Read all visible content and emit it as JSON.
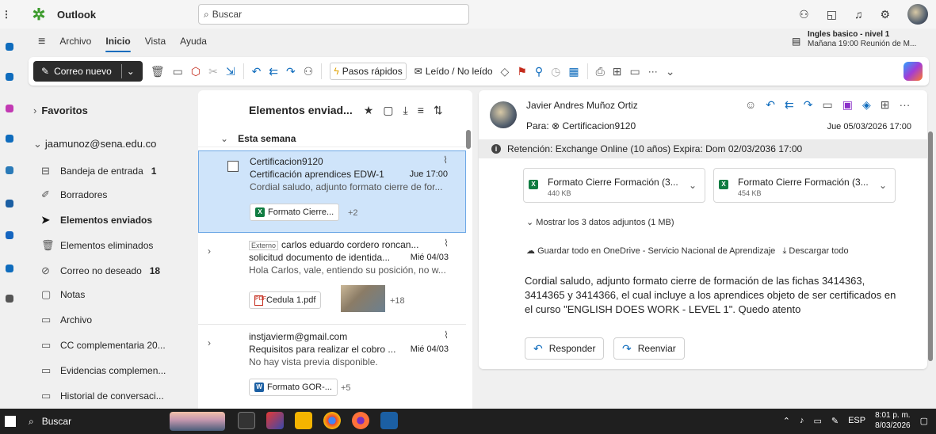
{
  "app": {
    "title": "Outlook",
    "search_placeholder": "Buscar"
  },
  "tabs": [
    "Archivo",
    "Inicio",
    "Vista",
    "Ayuda"
  ],
  "reminder": {
    "title": "Ingles basico - nivel 1",
    "detail": "Mañana 19:00 Reunión de M..."
  },
  "toolbar": {
    "new_mail": "Correo nuevo",
    "quick_steps": "Pasos rápidos",
    "read_unread": "Leído / No leído",
    "more": "···"
  },
  "folders": {
    "favorites": "Favoritos",
    "account": "jaamunoz@sena.edu.co",
    "items": [
      {
        "label": "Bandeja de entrada",
        "count": "1",
        "icon": "inbox-icon"
      },
      {
        "label": "Borradores",
        "count": "",
        "icon": "draft-icon"
      },
      {
        "label": "Elementos enviados",
        "count": "",
        "icon": "send-icon"
      },
      {
        "label": "Elementos eliminados",
        "count": "",
        "icon": "trash-icon"
      },
      {
        "label": "Correo no deseado",
        "count": "18",
        "icon": "junk-icon"
      },
      {
        "label": "Notas",
        "count": "",
        "icon": "note-icon"
      },
      {
        "label": "Archivo",
        "count": "",
        "icon": "archive-icon"
      },
      {
        "label": "CC complementaria 20...",
        "count": "",
        "icon": "folder-icon"
      },
      {
        "label": "Evidencias complemen...",
        "count": "",
        "icon": "folder-icon"
      },
      {
        "label": "Historial de conversaci...",
        "count": "",
        "icon": "folder-icon"
      }
    ]
  },
  "list": {
    "title": "Elementos enviad...",
    "group": "Esta semana",
    "messages": [
      {
        "tag": "",
        "sender": "Certificacion9120",
        "subject": "Certificación aprendices EDW-1",
        "date": "Jue 17:00",
        "preview": "Cordial saludo, adjunto formato cierre de for...",
        "attachment": "Formato Cierre...",
        "more": "+2"
      },
      {
        "tag": "Externo",
        "sender": "carlos eduardo cordero roncan...",
        "subject": "solicitud documento de identida...",
        "date": "Mié 04/03",
        "preview": "Hola Carlos, vale, entiendo su posición, no w...",
        "attachment": "Cedula 1.pdf",
        "more": "+18"
      },
      {
        "tag": "",
        "sender": "instjavierm@gmail.com",
        "subject": "Requisitos para realizar el cobro ...",
        "date": "Mié 04/03",
        "preview": "No hay vista previa disponible.",
        "attachment": "Formato GOR-...",
        "more": "+5"
      }
    ]
  },
  "reading": {
    "from": "Javier Andres Muñoz Ortiz",
    "to_label": "Para:",
    "to": "Certificacion9120",
    "date": "Jue 05/03/2026 17:00",
    "retention": "Retención: Exchange Online (10 años) Expira: Dom 02/03/2036 17:00",
    "attachments": [
      {
        "name": "Formato Cierre Formación (3...",
        "size": "440 KB"
      },
      {
        "name": "Formato Cierre Formación (3...",
        "size": "454 KB"
      }
    ],
    "show_attachments": "Mostrar los 3 datos adjuntos (1 MB)",
    "save_onedrive": "Guardar todo en OneDrive - Servicio Nacional de Aprendizaje",
    "download_all": "Descargar todo",
    "body": "Cordial saludo, adjunto formato cierre de formación de las fichas 3414363, 3414365 y 3414366, el cual incluye a los aprendices objeto de ser certificados en el curso \"ENGLISH DOES WORK - LEVEL 1\". Quedo atento",
    "reply": "Responder",
    "forward": "Reenviar"
  },
  "taskbar": {
    "search": "Buscar",
    "lang": "ESP",
    "time": "8:01 p. m.",
    "date": "8/03/2026"
  }
}
